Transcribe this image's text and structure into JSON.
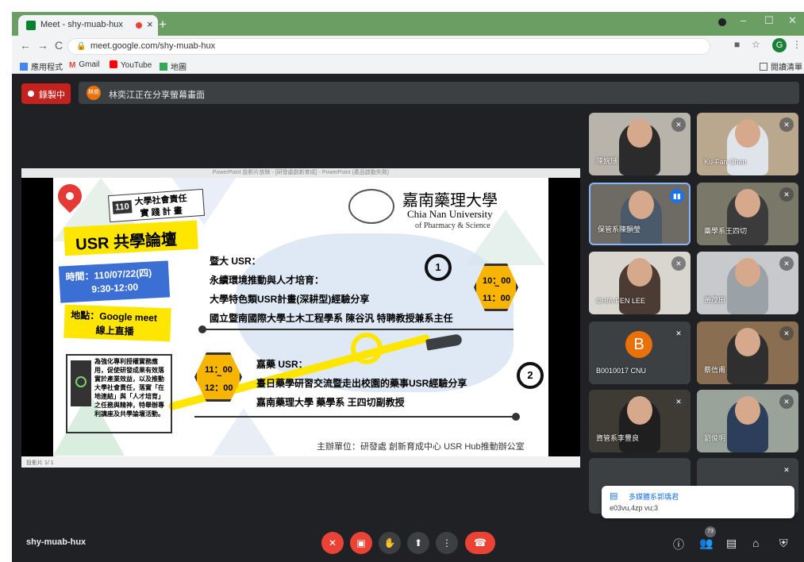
{
  "browser": {
    "tab_title": "Meet - shy-muab-hux",
    "tab_close": "×",
    "new_tab": "+",
    "url": "meet.google.com/shy-muab-hux",
    "profile_initial": "G",
    "bookmarks": [
      "應用程式",
      "Gmail",
      "YouTube",
      "地圖"
    ],
    "reading_list": "閱讀清單"
  },
  "meet": {
    "recording_label": "錄製中",
    "presenter_avatar": "林奕",
    "sharing_text": "林奕江正在分享螢幕畫面",
    "meeting_code": "shy-muab-hux",
    "participant_count": "73",
    "chat_notification": {
      "sender": "多媒體系郭瑀君",
      "message": "e03vu,4zp vu;3"
    }
  },
  "presentation": {
    "window_title": "PowerPoint 投影片放映 - [研發處創新育成] - PowerPoint (產品啟動失敗)",
    "status": "投影片 1/ 1",
    "slide": {
      "program_number": "110",
      "program_title_line1": "大學社會責任",
      "program_title_line2": "實 踐 計 畫",
      "forum_title": "USR 共學論壇",
      "time_label": "時間：110/07/22(四)",
      "time_range": "9:30-12:00",
      "location_line1": "地點：Google meet",
      "location_line2": "線上直播",
      "university_cn": "嘉南藥理大學",
      "university_en": "Chia Nan University",
      "university_en2": "of Pharmacy & Science",
      "talk1_school": "暨大 USR：",
      "talk1_line1": "永續環境推動與人才培育：",
      "talk1_line2": "大學特色類USR計畫(深耕型)經驗分享",
      "talk1_line3": "國立暨南國際大學土木工程學系 陳谷汎 特聘教授兼系主任",
      "talk1_number": "1",
      "talk1_time_start": "10：00",
      "talk1_time_end": "11：00",
      "talk2_school": "嘉藥 USR：",
      "talk2_line1": "臺日藥學研習交流暨走出校園的藥事USR經驗分享",
      "talk2_line2": "嘉南藥理大學 藥學系 王四切副教授",
      "talk2_number": "2",
      "talk2_time_start": "11：00",
      "talk2_time_end": "12：00",
      "tilde": "~",
      "purpose": "為強化專利授權實務應用，促使研發成果有效落實於產業效益，以及推動大學社會責任，落實「在地連結」與「人才培育」之任務與精神，特舉辦專利講座及共學論壇活動。",
      "organizer": "主辦單位：研發處 創新育成中心 USR Hub推動辦公室"
    }
  },
  "participants": [
    {
      "name": "陳婉珊"
    },
    {
      "name": "Ku-Fan Chen"
    },
    {
      "name": "保管系陳韻瑩"
    },
    {
      "name": "藥學系王四切"
    },
    {
      "name": "CHIA-FEN LEE"
    },
    {
      "name": "黃茂田"
    },
    {
      "name": "B0010017 CNU",
      "initial": "B"
    },
    {
      "name": "蔡信甫"
    },
    {
      "name": "資管系李豐良"
    },
    {
      "name": "劉俊明"
    }
  ],
  "colors": {
    "accent": "#1a73e8",
    "record_red": "#c5221f",
    "slide_yellow": "#ffe600",
    "slide_blue": "#3b6fd4",
    "hex_orange": "#f7b500"
  }
}
